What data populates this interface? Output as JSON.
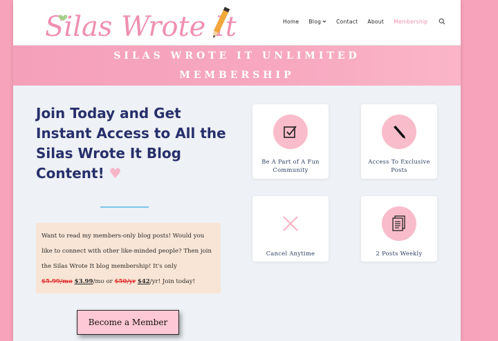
{
  "site": {
    "logo_text": "Silas Wrote It"
  },
  "nav": {
    "items": [
      {
        "label": "Home",
        "active": false
      },
      {
        "label": "Blog",
        "active": false,
        "dropdown": true
      },
      {
        "label": "Contact",
        "active": false
      },
      {
        "label": "About",
        "active": false
      },
      {
        "label": "Membership",
        "active": true
      }
    ],
    "search_icon": "search-icon"
  },
  "banner": {
    "line1": "SILAS WROTE IT UNLIMITED",
    "line2": "MEMBERSHIP"
  },
  "main": {
    "headline": "Join Today and Get Instant Access to All the Silas Wrote It Blog Content!",
    "heart": "♥",
    "info_text": "Want to read my members-only blog posts! Would you like to connect with other like-minded people? Then join the Silas Wrote It blog membership! It's only",
    "old_monthly": "$5.99/mo",
    "new_monthly": "$3.99",
    "monthly_unit": "/mo or",
    "old_yearly": "$50/yr",
    "new_yearly": "$42",
    "yearly_unit": "/yr!",
    "join_text": "Join today!",
    "cta_label": "Become a Member"
  },
  "features": [
    {
      "label": "Be A Part of A Fun Community",
      "icon": "checkbox-icon"
    },
    {
      "label": "Access To Exclusive Posts",
      "icon": "pen-icon"
    },
    {
      "label": "Cancel Anytime",
      "icon": "close-icon"
    },
    {
      "label": "2 Posts Weekly",
      "icon": "document-icon"
    }
  ],
  "colors": {
    "brand_pink": "#ef8fb2",
    "headline_navy": "#27306b",
    "background_pink": "#f7a3bb",
    "info_box": "#f9e5d5",
    "cta_bg": "#ffc8d6"
  }
}
